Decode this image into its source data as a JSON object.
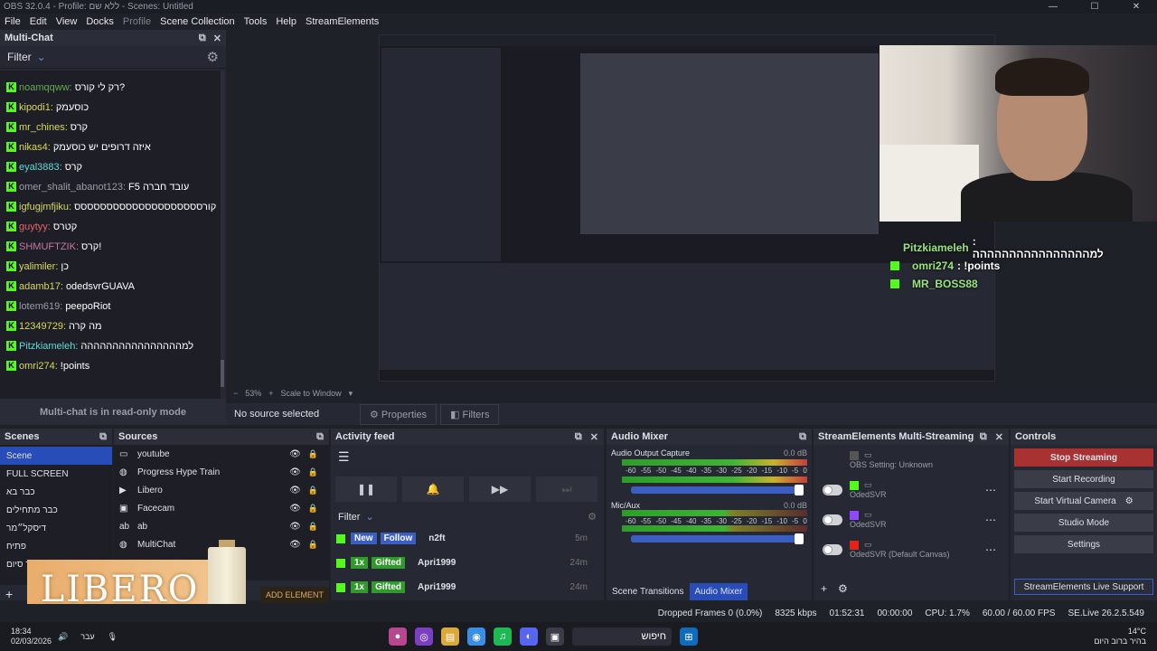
{
  "window": {
    "title": "OBS 32.0.4 - Profile: ללא שם - Scenes: Untitled"
  },
  "menu": [
    "File",
    "Edit",
    "View",
    "Docks",
    "Profile",
    "Scene Collection",
    "Tools",
    "Help",
    "StreamElements"
  ],
  "multichat": {
    "title": "Multi-Chat",
    "filter_label": "Filter",
    "readonly": "Multi-chat is in read-only mode",
    "messages": [
      {
        "user": "noamqqww:",
        "text": "רק לי קורס?",
        "color": "#6aa84f"
      },
      {
        "user": "kipodi1:",
        "text": "כוסעמק",
        "color": "#d9d95f"
      },
      {
        "user": "mr_chines:",
        "text": "קרס",
        "color": "#d9d95f"
      },
      {
        "user": "nikas4:",
        "text": "איזה דרופים יש כוסעמק",
        "color": "#d9d95f"
      },
      {
        "user": "eyal3883:",
        "text": "קרס",
        "color": "#5fd9d9"
      },
      {
        "user": "omer_shalit_abanot123:",
        "text": "F5 עובד חברה",
        "color": "#9a9ca6"
      },
      {
        "user": "igfugjmfjiku:",
        "text": "קורסססססססססססססססססססס",
        "color": "#d9d95f"
      },
      {
        "user": "guytyy:",
        "text": "קטרס",
        "color": "#e06666"
      },
      {
        "user": "SHMUFTZIK:",
        "text": "קרס!",
        "color": "#c27ba0"
      },
      {
        "user": "yalimiler:",
        "text": "כן",
        "color": "#d9d95f"
      },
      {
        "user": "adamb17:",
        "text": "odedsvrGUAVA",
        "color": "#d9d95f"
      },
      {
        "user": "lotem619:",
        "text": "peepoRiot",
        "color": "#9a9ca6"
      },
      {
        "user": "12349729:",
        "text": "מה קרה",
        "color": "#d9d95f"
      },
      {
        "user": "Pitzkiameleh:",
        "text": "למהההההההההההההההה",
        "color": "#5fd9d9"
      },
      {
        "user": "omri274:",
        "text": "!points",
        "color": "#d9d95f"
      }
    ]
  },
  "preview": {
    "zoom": "53%",
    "scale_mode": "Scale to Window",
    "overlay_rows": [
      {
        "user": "Pitzkiameleh",
        "text": ": למהההההההההההההההה"
      },
      {
        "user": "omri274",
        "text": ": !points"
      },
      {
        "user": "MR_BOSS88",
        "text": ""
      }
    ]
  },
  "source_toolbar": {
    "no_source": "No source selected",
    "properties": "Properties",
    "filters": "Filters"
  },
  "scenes": {
    "title": "Scenes",
    "items": [
      "Scene",
      "FULL SCREEN",
      "כבר בא",
      "כבר מתחילים",
      "דיסקל״מר",
      "פתיח",
      "בר סיום"
    ]
  },
  "sources": {
    "title": "Sources",
    "items": [
      {
        "name": "youtube",
        "icon": "window-icon"
      },
      {
        "name": "Progress Hype Train",
        "icon": "globe-icon"
      },
      {
        "name": "Libero",
        "icon": "play-icon"
      },
      {
        "name": "Facecam",
        "icon": "camera-icon"
      },
      {
        "name": "ab",
        "icon": "text-icon"
      },
      {
        "name": "MultiChat",
        "icon": "globe-icon"
      }
    ]
  },
  "activity": {
    "title": "Activity feed",
    "filter": "Filter",
    "events": [
      {
        "badge": "New",
        "badge2": "Follow",
        "user": "n2ft",
        "time": "5m",
        "color": "#3a5fc0"
      },
      {
        "badge": "1x",
        "badge2": "Gifted",
        "user": "Apri1999",
        "time": "24m",
        "color": "#2f9c2a"
      },
      {
        "badge": "1x",
        "badge2": "Gifted",
        "user": "Apri1999",
        "time": "24m",
        "color": "#2f9c2a"
      }
    ]
  },
  "mixer": {
    "title": "Audio Mixer",
    "channels": [
      {
        "name": "Audio Output Capture",
        "db": "0.0 dB"
      },
      {
        "name": "Mic/Aux",
        "db": "0.0 dB"
      }
    ],
    "ticks": [
      "-60",
      "-55",
      "-50",
      "-45",
      "-40",
      "-35",
      "-30",
      "-25",
      "-20",
      "-15",
      "-10",
      "-5",
      "0"
    ],
    "tab_transitions": "Scene Transitions",
    "tab_mixer": "Audio Mixer"
  },
  "multistream": {
    "title": "StreamElements Multi-Streaming",
    "accounts": [
      {
        "label": "OBS Setting: Unknown"
      },
      {
        "label": "OdedSVR"
      },
      {
        "label": "OdedSVR"
      },
      {
        "label": "OdedSVR (Default Canvas)"
      }
    ]
  },
  "controls": {
    "title": "Controls",
    "stop": "Stop Streaming",
    "record": "Start Recording",
    "vcam": "Start Virtual Camera",
    "studio": "Studio Mode",
    "settings": "Settings",
    "live": "StreamElements Live Support"
  },
  "status": {
    "dropped": "Dropped Frames 0 (0.0%)",
    "kbps": "8325 kbps",
    "live_time": "01:52:31",
    "rec_time": "00:00:00",
    "cpu": "CPU: 1.7%",
    "fps": "60.00 / 60.00 FPS",
    "version": "SE.Live 26.2.5.549"
  },
  "libero": {
    "brand": "LIBERO",
    "add": "ADD ELEMENT"
  },
  "taskbar": {
    "time": "18:34",
    "date": "02/03/2026",
    "lang": "עבר",
    "search": "חיפוש",
    "temp": "14°C",
    "weather": "בהיר ברוב היום"
  }
}
